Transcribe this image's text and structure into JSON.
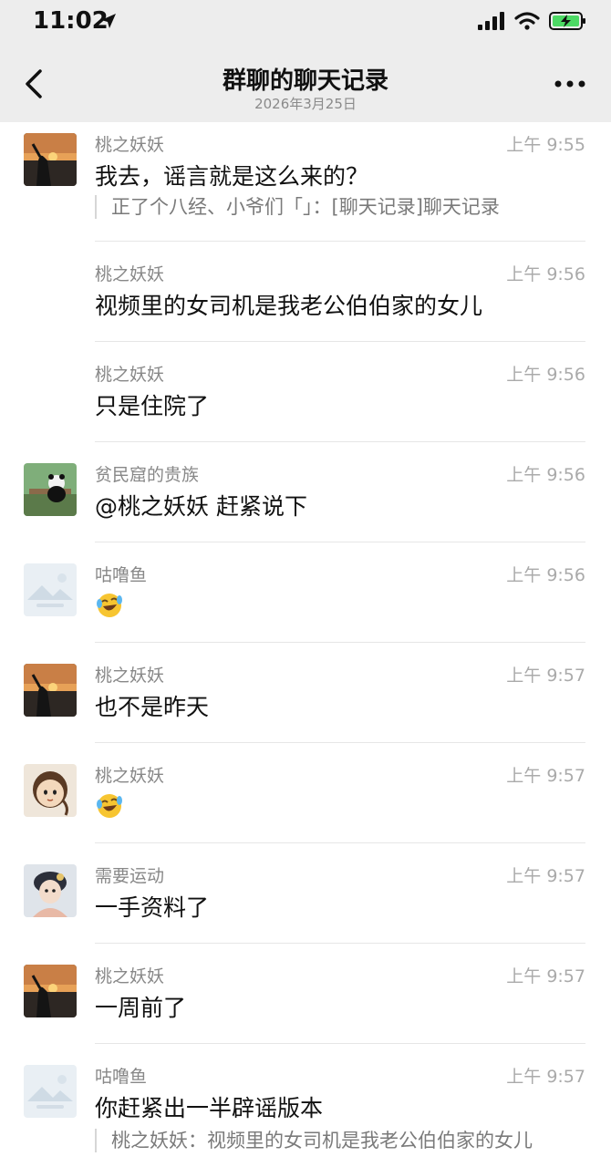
{
  "status_bar": {
    "time": "11:02"
  },
  "nav": {
    "title": "群聊的聊天记录",
    "subtitle": "2026年3月25日"
  },
  "messages": [
    {
      "sender": "桃之妖妖",
      "time": "上午 9:55",
      "text": "我去，谣言就是这么来的？",
      "quote": "正了个八经、小爷们「」：[聊天记录]聊天记录",
      "avatar": "sunset-avatar"
    },
    {
      "sender": "桃之妖妖",
      "time": "上午 9:56",
      "text": "视频里的女司机是我老公伯伯家的女儿"
    },
    {
      "sender": "桃之妖妖",
      "time": "上午 9:56",
      "text": "只是住院了"
    },
    {
      "sender": "贫民窟的贵族",
      "time": "上午 9:56",
      "text": "@桃之妖妖 赶紧说下",
      "avatar": "panda-avatar"
    },
    {
      "sender": "咕噜鱼",
      "time": "上午 9:56",
      "text": "",
      "emoji": "laughing-crying-emoji",
      "avatar": "placeholder-image-avatar"
    },
    {
      "sender": "桃之妖妖",
      "time": "上午 9:57",
      "text": "也不是昨天",
      "avatar": "sunset-avatar"
    },
    {
      "sender": "桃之妖妖",
      "time": "上午 9:57",
      "text": "",
      "emoji": "laughing-crying-emoji",
      "avatar": "cartoon-girl-avatar"
    },
    {
      "sender": "需要运动",
      "time": "上午 9:57",
      "text": "一手资料了",
      "avatar": "doll-avatar"
    },
    {
      "sender": "桃之妖妖",
      "time": "上午 9:57",
      "text": "一周前了",
      "avatar": "sunset-avatar"
    },
    {
      "sender": "咕噜鱼",
      "time": "上午 9:57",
      "text": "你赶紧出一半辟谣版本",
      "quote": "桃之妖妖：视频里的女司机是我老公伯伯家的女儿",
      "avatar": "placeholder-image-avatar"
    }
  ]
}
